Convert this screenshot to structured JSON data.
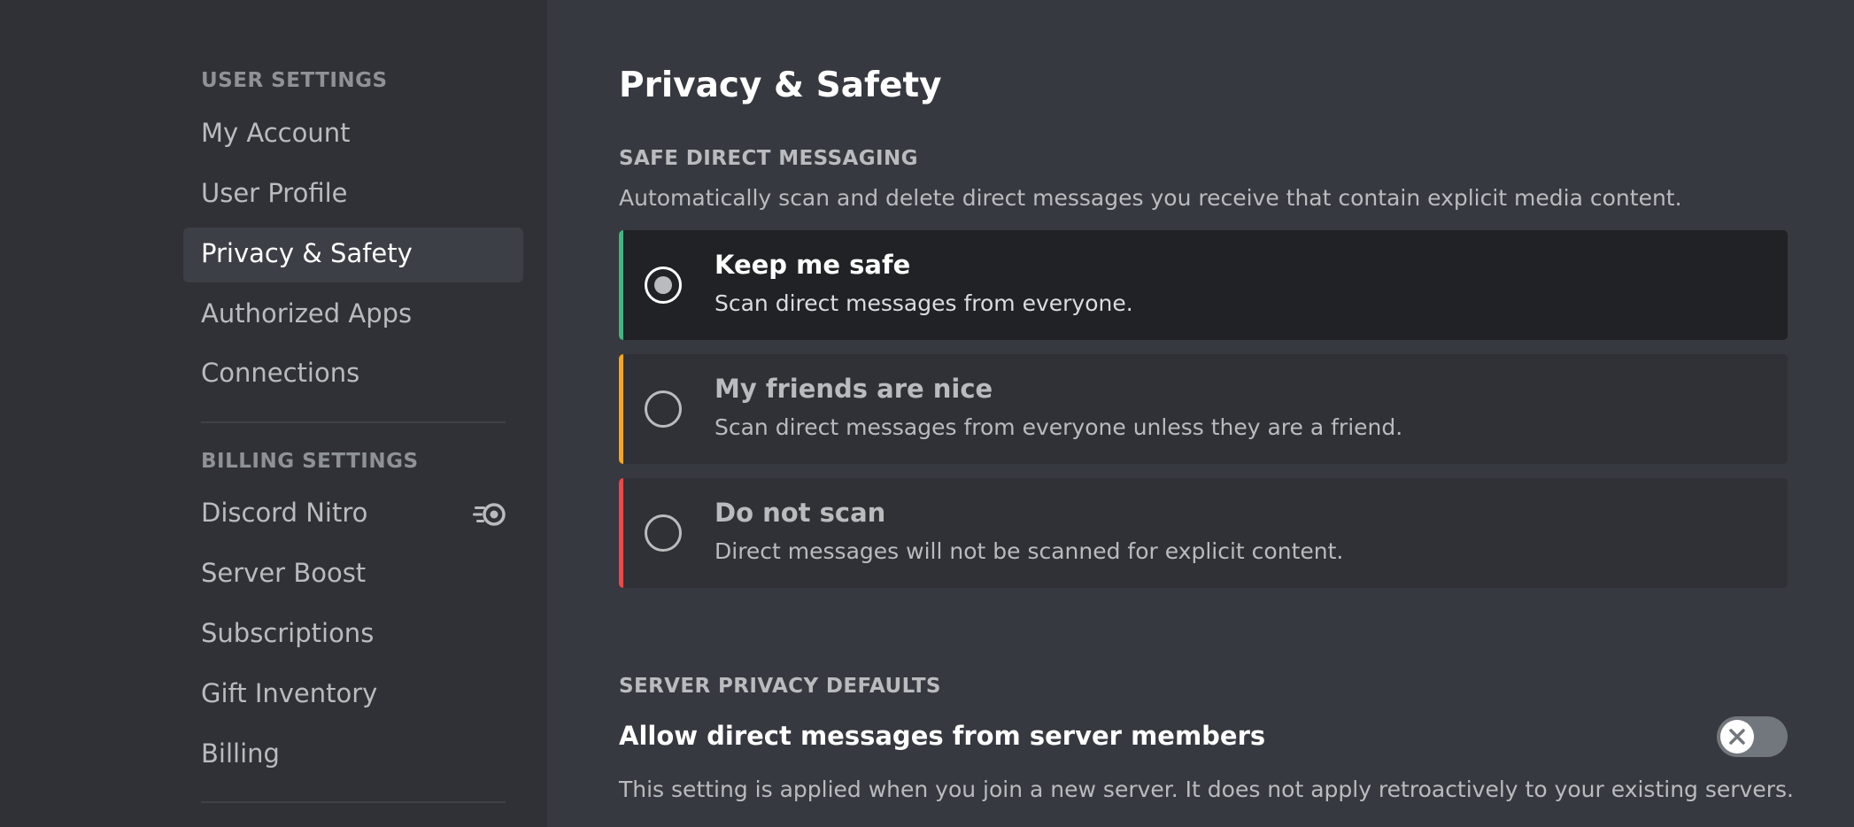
{
  "sidebar": {
    "user_settings_heading": "User Settings",
    "user_items": [
      {
        "label": "My Account"
      },
      {
        "label": "User Profile"
      },
      {
        "label": "Privacy & Safety",
        "selected": true
      },
      {
        "label": "Authorized Apps"
      },
      {
        "label": "Connections"
      }
    ],
    "billing_settings_heading": "Billing Settings",
    "billing_items": [
      {
        "label": "Discord Nitro",
        "icon": "nitro-icon"
      },
      {
        "label": "Server Boost"
      },
      {
        "label": "Subscriptions"
      },
      {
        "label": "Gift Inventory"
      },
      {
        "label": "Billing"
      }
    ]
  },
  "main": {
    "title": "Privacy & Safety",
    "safe_dm": {
      "heading": "Safe Direct Messaging",
      "description": "Automatically scan and delete direct messages you receive that contain explicit media content.",
      "options": [
        {
          "title": "Keep me safe",
          "description": "Scan direct messages from everyone.",
          "selected": true,
          "color": "#43b581"
        },
        {
          "title": "My friends are nice",
          "description": "Scan direct messages from everyone unless they are a friend.",
          "selected": false,
          "color": "#faa61a"
        },
        {
          "title": "Do not scan",
          "description": "Direct messages will not be scanned for explicit content.",
          "selected": false,
          "color": "#f04747"
        }
      ]
    },
    "server_privacy": {
      "heading": "Server Privacy Defaults",
      "setting_title": "Allow direct messages from server members",
      "setting_description": "This setting is applied when you join a new server. It does not apply retroactively to your existing servers.",
      "toggle_enabled": false
    }
  },
  "colors": {
    "sidebar_bg": "#2f3136",
    "main_bg": "#36393f",
    "selected_item_bg": "#3c3f45",
    "selected_option_bg": "#202225"
  }
}
